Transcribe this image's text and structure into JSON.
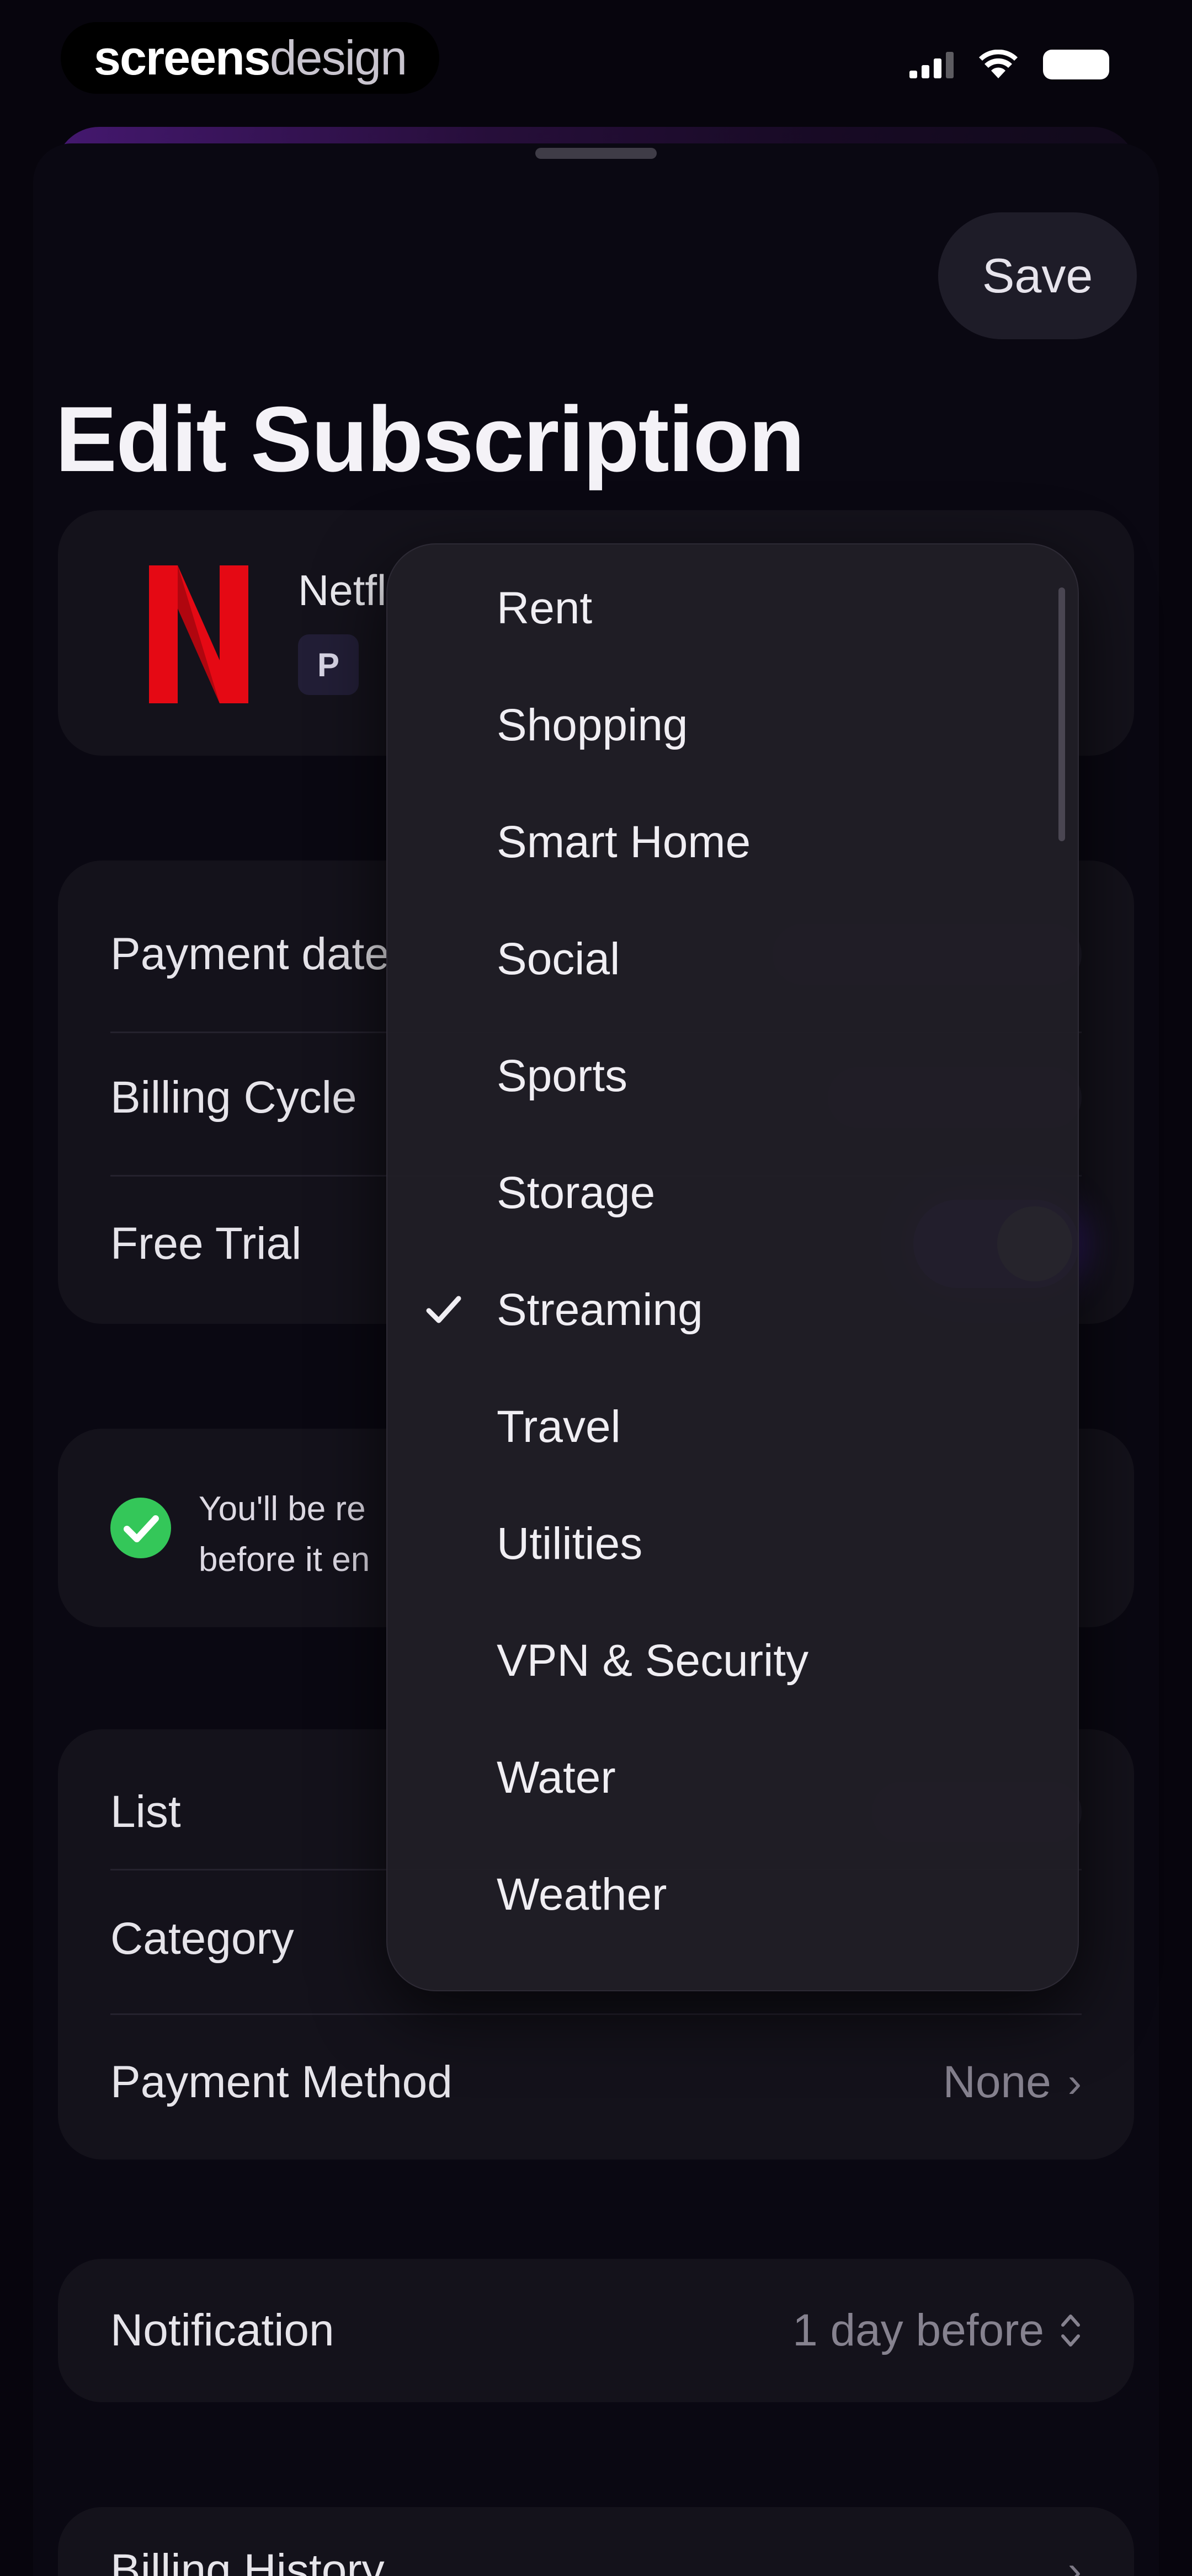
{
  "status_bar": {
    "brand_bold": "screens",
    "brand_light": "design"
  },
  "header": {
    "save_label": "Save",
    "title": "Edit Subscription"
  },
  "service": {
    "name": "Netfl",
    "badge": "P",
    "brand_color": "#E50914"
  },
  "details": {
    "payment_date_label": "Payment date",
    "billing_cycle_label": "Billing Cycle",
    "free_trial_label": "Free Trial",
    "free_trial_on": true,
    "accent_color": "#5B2BD3"
  },
  "reminder": {
    "line1": "You'll be re",
    "line2": "before it en"
  },
  "organize": {
    "list_label": "List",
    "category_label": "Category",
    "payment_method_label": "Payment Method",
    "payment_method_value": "None"
  },
  "notification": {
    "label": "Notification",
    "value": "1 day before"
  },
  "billing_history": {
    "label": "Billing History"
  },
  "category_menu": {
    "selected_index": 6,
    "items": [
      {
        "label": "Rent"
      },
      {
        "label": "Shopping"
      },
      {
        "label": "Smart Home"
      },
      {
        "label": "Social"
      },
      {
        "label": "Sports"
      },
      {
        "label": "Storage"
      },
      {
        "label": "Streaming"
      },
      {
        "label": "Travel"
      },
      {
        "label": "Utilities"
      },
      {
        "label": "VPN & Security"
      },
      {
        "label": "Water"
      },
      {
        "label": "Weather"
      }
    ]
  }
}
